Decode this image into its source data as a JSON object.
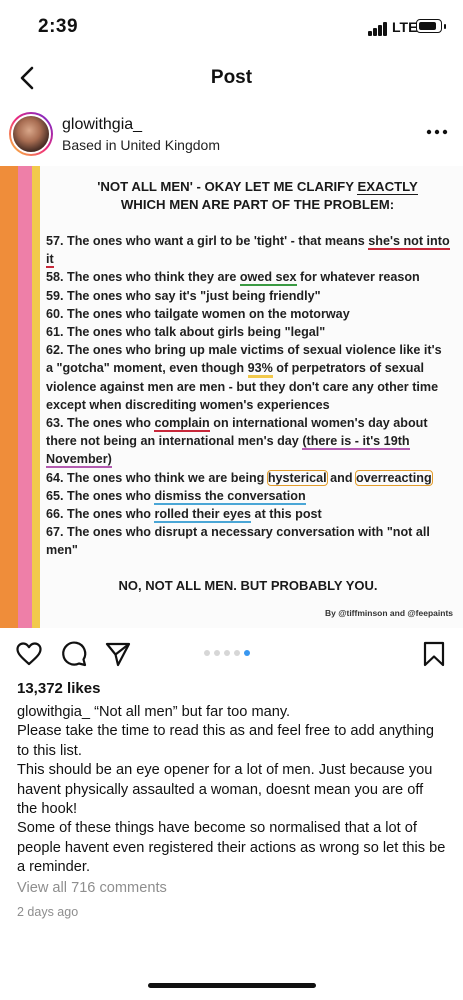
{
  "status_bar": {
    "time": "2:39",
    "network": "LTE",
    "battery_level": 0.85
  },
  "nav": {
    "title": "Post",
    "back_icon": "chevron-left-icon"
  },
  "post": {
    "username": "glowithgia_",
    "location": "Based in United Kingdom",
    "more_icon": "ellipsis-icon"
  },
  "image": {
    "heading_line1_a": "'NOT ALL MEN' - OKAY LET ME CLARIFY ",
    "heading_line1_b": "EXACTLY",
    "heading_line2": "WHICH MEN ARE PART OF THE PROBLEM:",
    "i57_a": "57. The ones who want a girl to be 'tight' - that means ",
    "i57_b": "she's not into it",
    "i58_a": "58. The ones who think they are ",
    "i58_b": "owed sex",
    "i58_c": " for whatever reason",
    "i59": "59. The ones who say it's \"just being friendly\"",
    "i60": "60. The ones who tailgate women on the motorway",
    "i61": "61. The ones who talk about girls being \"legal\"",
    "i62_a": "62. The ones who bring up male victims of sexual violence like it's a \"gotcha\" moment, even though ",
    "i62_b": "93%",
    "i62_c": " of perpetrators of sexual violence against men are men - but they don't care any other time except when discrediting women's experiences",
    "i63_a": "63. The ones who ",
    "i63_b": "complain",
    "i63_c": " on international women's day about there not being an international men's day ",
    "i63_d": "(there is - it's 19th November)",
    "i64_a": "64. The ones who think we are being ",
    "i64_b": "hysterical",
    "i64_c": " and ",
    "i64_d": "overreacting",
    "i65_a": "65. The ones who ",
    "i65_b": "dismiss the conversation",
    "i66_a": "66. The ones who ",
    "i66_b": "rolled their eyes",
    "i66_c": " at this post",
    "i67": "67. The ones who disrupt a necessary conversation with \"not all men\"",
    "closing": "NO, NOT ALL MEN. BUT PROBABLY YOU.",
    "credit": "By @tiffminson and @feepaints",
    "colors": {
      "orange": "#ef8d3a",
      "pink": "#ee7fa8",
      "yellow": "#f2c94c"
    }
  },
  "actions": {
    "icons": [
      "heart-icon",
      "comment-icon",
      "share-icon",
      "bookmark-icon"
    ],
    "carousel_count": 5,
    "carousel_active_index": 4,
    "accent": "#3897f0"
  },
  "likes": "13,372 likes",
  "caption": {
    "user": "glowithgia_",
    "p1": "“Not all men” but far too many.",
    "p2": "Please take the time to read this as and feel free to add anything to this list.",
    "p3": "This should be an eye opener for a lot of men. Just because you havent physically assaulted a woman, doesnt mean you are off the hook!",
    "p4": "Some of these things have become so normalised that a lot of people havent even registered their actions as wrong so let this be a reminder."
  },
  "comments_link": "View all 716 comments",
  "timestamp": "2 days ago"
}
